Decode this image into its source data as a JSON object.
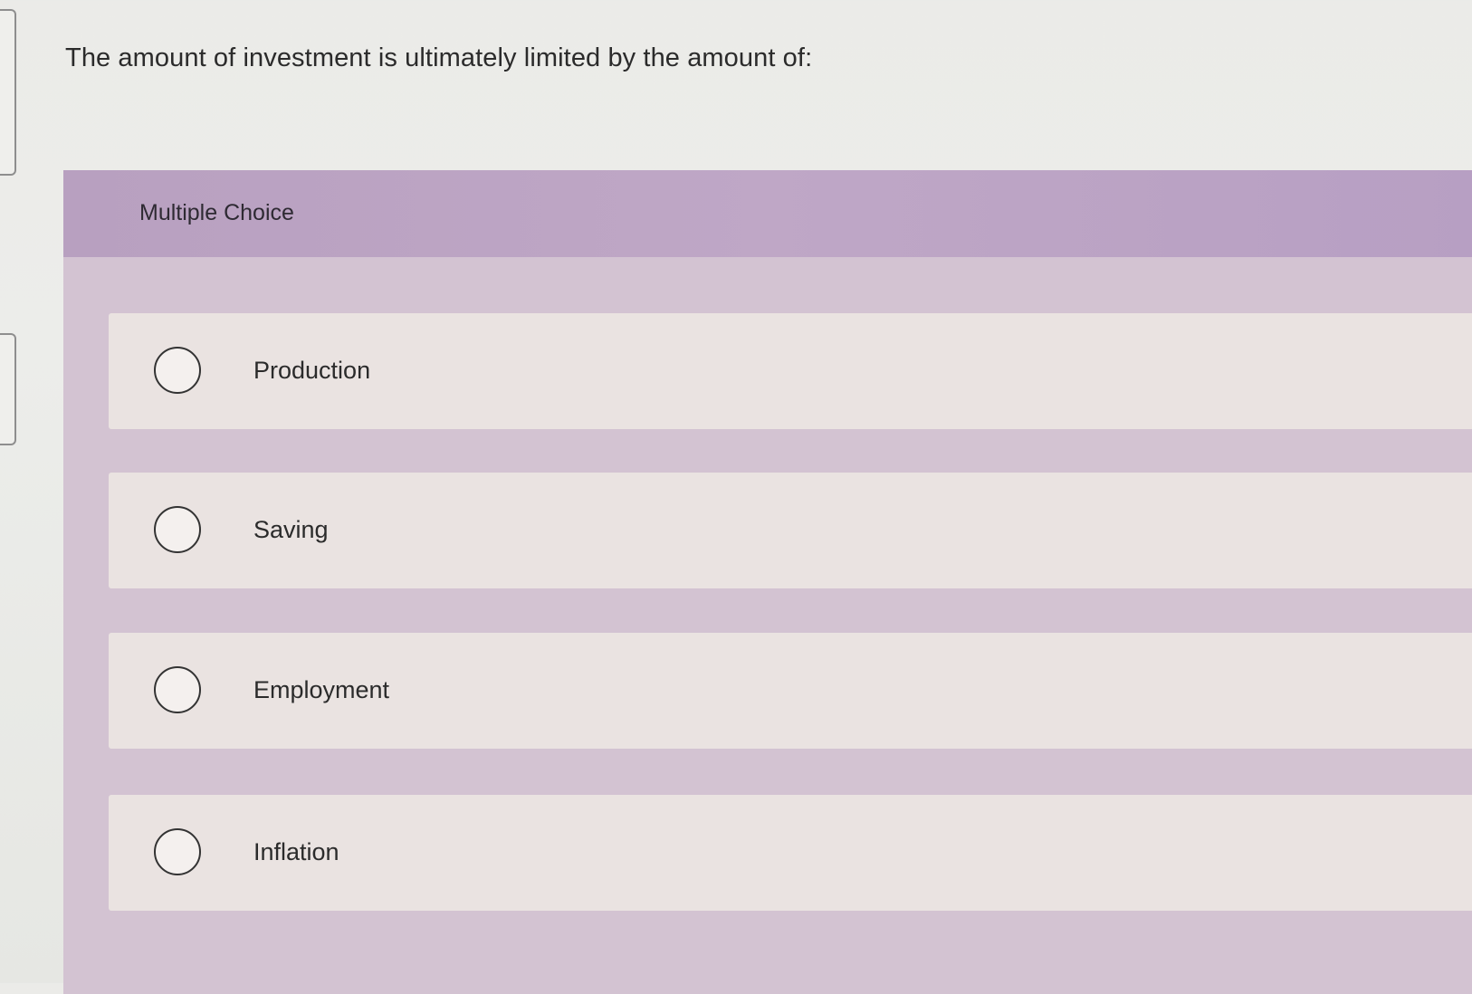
{
  "question": {
    "text": "The amount of investment is ultimately limited by the amount of:"
  },
  "multiple_choice": {
    "header_label": "Multiple Choice",
    "options": [
      {
        "label": "Production",
        "selected": false
      },
      {
        "label": "Saving",
        "selected": false
      },
      {
        "label": "Employment",
        "selected": false
      },
      {
        "label": "Inflation",
        "selected": false
      }
    ]
  },
  "colors": {
    "header_background": "#bfa7c6",
    "panel_background": "#d3c3d2",
    "option_background": "#eae3e1",
    "page_background": "#ecedea"
  }
}
